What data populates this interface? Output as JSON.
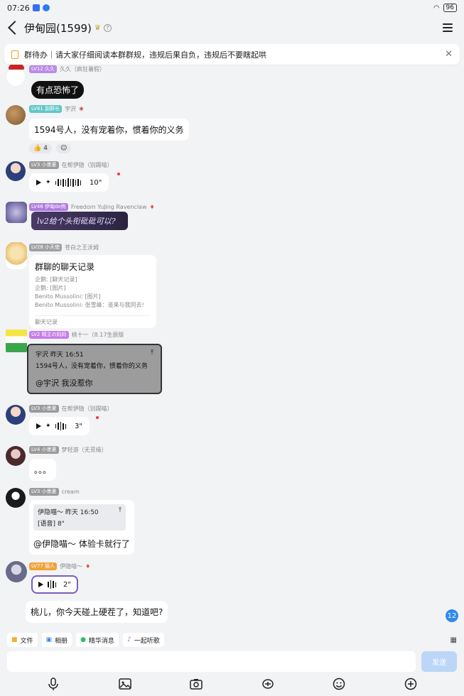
{
  "status": {
    "time": "07:26",
    "battery": "96"
  },
  "header": {
    "title": "伊甸园(1599)"
  },
  "notice": {
    "text": "群待办｜请大家仔细阅读本群群规，违规后果自负，违规后不要瞎起哄"
  },
  "messages": [
    {
      "level": "LV12 久久",
      "name": "久久（疯狂暑假）",
      "text": "有点恐怖了",
      "level_color": "#b98be6"
    },
    {
      "level": "LV81 副群长",
      "name": "宇沢",
      "text": "1594号人，没有宠着你，惯着你的义务",
      "level_color": "#5fc6c9",
      "reaction_count": "4"
    },
    {
      "level": "LV3 小墨夏",
      "name": "在帮伊隐（别踢喵）",
      "duration": "10\"",
      "level_color": "#9a9a9a"
    },
    {
      "level": "LV46 伊甸de狗",
      "name": "Freedom YuJing Ravenclaw",
      "text": "lv2给个头衔砒砒可以?",
      "level_color": "#b07ae0"
    },
    {
      "level": "LV28 小天使",
      "name": "苍白之王沃姆",
      "level_color": "#a0a0a0",
      "record": {
        "title": "群聊的聊天记录",
        "lines": [
          "企鹅: [聊天记录]",
          "企鹅: [图片]",
          "Benito Mussolini: [图片]",
          "Benito Mussolini: 张雪峰：谁来与我同去!"
        ],
        "footer": "聊天记录"
      }
    },
    {
      "level": "LV2 精主の妈妈",
      "name": "桃十一（8.17生辰版",
      "level_color": "#c77be8",
      "quote": {
        "header": "宇沢 昨天 16:51",
        "text": "1594号人，没有宠着你，惯着你的义务"
      },
      "reply": "@宇沢 我没惹你"
    },
    {
      "level": "LV3 小墨夏",
      "name": "在帮伊隐（别踢喵）",
      "duration": "3\"",
      "level_color": "#9a9a9a"
    },
    {
      "level": "LV4 小墨夏",
      "name": "梦轻游（无觅缘）",
      "text": "。。。",
      "level_color": "#9a9a9a"
    },
    {
      "level": "LV3 小墨夏",
      "name": "cream",
      "level_color": "#9a9a9a",
      "quote": {
        "header": "伊隐喵～ 昨天 16:50",
        "text": "[语音] 8\""
      },
      "reply": "@伊隐喵～ 体验卡就行了"
    },
    {
      "level": "LV77 猫人",
      "name": "伊隐喵～",
      "duration": "2\"",
      "level_color": "#f0a23a",
      "text": "桃儿，你今天碰上硬茬了，知道吧?"
    }
  ],
  "unread": "12",
  "toolbar": {
    "file": "文件",
    "album": "相册",
    "highlights": "精华消息",
    "listen": "一起听歌"
  },
  "input": {
    "placeholder": "",
    "send": "发送"
  },
  "colors": {
    "accent": "#2f89ee",
    "send_disabled": "#bcd6f7",
    "notice_icon": "#e3a313"
  }
}
